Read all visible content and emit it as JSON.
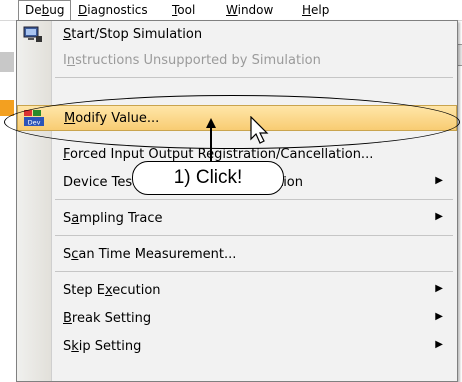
{
  "menubar": {
    "items": [
      {
        "label": "Debug",
        "active": true
      },
      {
        "label": "Diagnostics"
      },
      {
        "label": "Tool"
      },
      {
        "label": "Window"
      },
      {
        "label": "Help"
      }
    ]
  },
  "menu": {
    "items": [
      {
        "label": "Start/Stop Simulation",
        "icon": "simulation-icon"
      },
      {
        "label": "Instructions Unsupported by Simulation",
        "disabled": true
      },
      {
        "label": "Modify Value...",
        "icon": "modify-value-icon",
        "highlighted": true
      },
      {
        "label": "Forced Input Output Registration/Cancellation..."
      },
      {
        "label": "Device Test with Execution Condition",
        "submenu": true
      },
      {
        "label": "Sampling Trace",
        "submenu": true
      },
      {
        "label": "Scan Time Measurement..."
      },
      {
        "label": "Step Execution",
        "submenu": true
      },
      {
        "label": "Break Setting",
        "submenu": true
      },
      {
        "label": "Skip Setting",
        "submenu": true
      }
    ]
  },
  "annotation": {
    "callout_text": "1) Click!"
  },
  "colors": {
    "highlight_top": "#ffe6a8",
    "highlight_bottom": "#f8cc73",
    "disabled_text": "#9b9b9b"
  }
}
